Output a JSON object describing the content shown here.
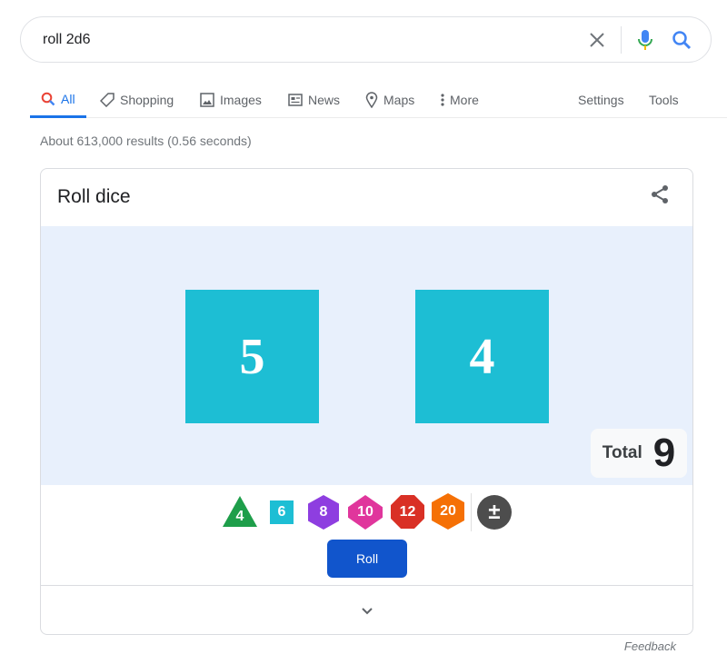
{
  "search": {
    "query": "roll 2d6"
  },
  "tabs": [
    {
      "label": "All",
      "icon": "search-icon"
    },
    {
      "label": "Shopping",
      "icon": "tag-icon"
    },
    {
      "label": "Images",
      "icon": "image-icon"
    },
    {
      "label": "News",
      "icon": "news-icon"
    },
    {
      "label": "Maps",
      "icon": "map-pin-icon"
    },
    {
      "label": "More",
      "icon": "more-vert-icon"
    }
  ],
  "tools": {
    "settings": "Settings",
    "tools": "Tools"
  },
  "stats": "About 613,000 results (0.56 seconds)",
  "card": {
    "title": "Roll dice",
    "dice_values": [
      "5",
      "4"
    ],
    "total_label": "Total",
    "total_value": "9",
    "die_types": [
      {
        "label": "4",
        "shape": "triangle",
        "color": "#1e9e4a"
      },
      {
        "label": "6",
        "shape": "square",
        "color": "#1dbed4"
      },
      {
        "label": "8",
        "shape": "hexagon",
        "color": "#8e3ee0"
      },
      {
        "label": "10",
        "shape": "diamond-hex",
        "color": "#e0369c"
      },
      {
        "label": "12",
        "shape": "octagon",
        "color": "#d93025"
      },
      {
        "label": "20",
        "shape": "hexagon",
        "color": "#f57005"
      }
    ],
    "modifier_label": "±",
    "roll_label": "Roll",
    "die_color": "#1dbed4",
    "stage_color": "#e8f0fc"
  },
  "feedback": "Feedback"
}
